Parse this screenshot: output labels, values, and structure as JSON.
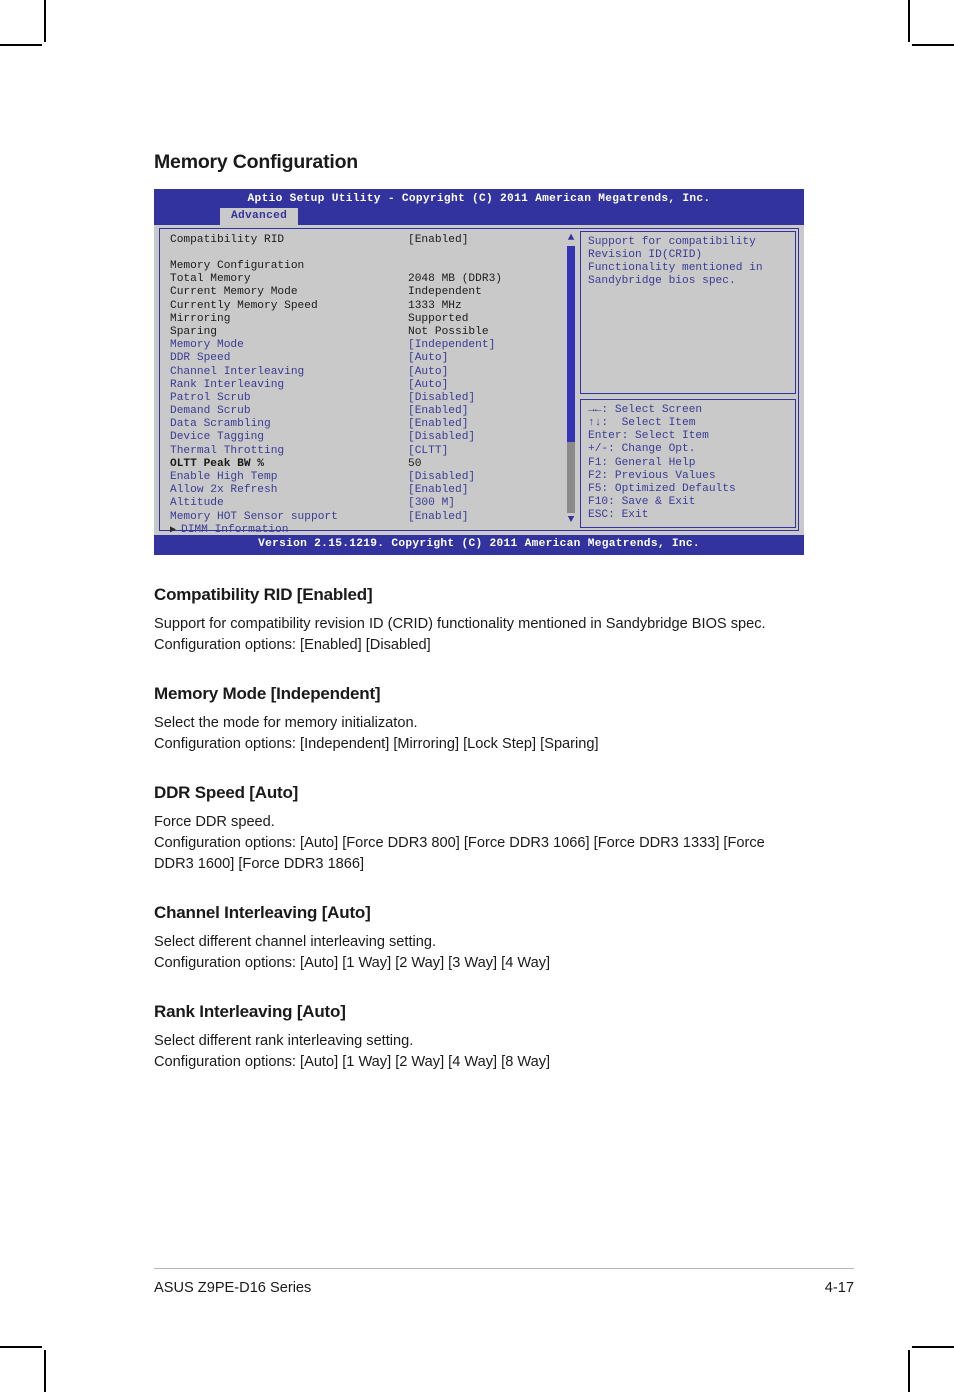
{
  "page": {
    "section_title": "Memory Configuration",
    "footer_left": "ASUS Z9PE-D16 Series",
    "footer_right": "4-17"
  },
  "bios": {
    "title": "Aptio Setup Utility - Copyright (C) 2011 American Megatrends, Inc.",
    "tab": "Advanced",
    "footer": "Version 2.15.1219. Copyright (C) 2011 American Megatrends, Inc.",
    "items": [
      {
        "label": "Compatibility RID",
        "value": "[Enabled]",
        "style": "dark"
      },
      {
        "label": "",
        "value": "",
        "style": "spacer"
      },
      {
        "label": "Memory Configuration",
        "value": "",
        "style": "dark"
      },
      {
        "label": "Total Memory",
        "value": "2048 MB (DDR3)",
        "style": "dark"
      },
      {
        "label": "Current Memory Mode",
        "value": "Independent",
        "style": "dark"
      },
      {
        "label": "Currently Memory Speed",
        "value": "1333 MHz",
        "style": "dark"
      },
      {
        "label": "Mirroring",
        "value": "Supported",
        "style": "dark"
      },
      {
        "label": "Sparing",
        "value": "Not Possible",
        "style": "dark"
      },
      {
        "label": "Memory Mode",
        "value": "[Independent]",
        "style": "blue"
      },
      {
        "label": "DDR Speed",
        "value": "[Auto]",
        "style": "blue"
      },
      {
        "label": "Channel Interleaving",
        "value": "[Auto]",
        "style": "blue"
      },
      {
        "label": "Rank Interleaving",
        "value": "[Auto]",
        "style": "blue"
      },
      {
        "label": "Patrol Scrub",
        "value": "[Disabled]",
        "style": "blue"
      },
      {
        "label": "Demand Scrub",
        "value": "[Enabled]",
        "style": "blue"
      },
      {
        "label": "Data Scrambling",
        "value": "[Enabled]",
        "style": "blue"
      },
      {
        "label": "Device Tagging",
        "value": "[Disabled]",
        "style": "blue"
      },
      {
        "label": "Thermal Throtting",
        "value": "[CLTT]",
        "style": "blue"
      },
      {
        "label": "OLTT Peak BW %",
        "value": "50",
        "style": "bold"
      },
      {
        "label": "Enable High Temp",
        "value": "[Disabled]",
        "style": "blue"
      },
      {
        "label": "Allow 2x Refresh",
        "value": "[Enabled]",
        "style": "blue"
      },
      {
        "label": "Altitude",
        "value": "[300 M]",
        "style": "blue"
      },
      {
        "label": "Memory HOT Sensor support",
        "value": "[Enabled]",
        "style": "blue"
      },
      {
        "label": "DIMM Information",
        "value": "",
        "style": "submenu"
      }
    ],
    "help_text": "Support for compatibility\nRevision ID(CRID)\nFunctionality mentioned in\nSandybridge bios spec.",
    "keys": [
      "→←: Select Screen",
      "↑↓:  Select Item",
      "Enter: Select Item",
      "+/-: Change Opt.",
      "F1: General Help",
      "F2: Previous Values",
      "F5: Optimized Defaults",
      "F10: Save & Exit",
      "ESC: Exit"
    ],
    "scrollbar": {
      "up_arrow": "▲",
      "down_arrow": "▼"
    },
    "colors": {
      "header_blue": "#3333a0",
      "panel_gray": "#c9c9c9",
      "item_blue": "#3b3b96"
    }
  },
  "doc": {
    "sections": [
      {
        "heading": "Compatibility RID [Enabled]",
        "lines": [
          "Support for compatibility revision ID (CRID) functionality mentioned in Sandybridge BIOS spec. Configuration options: [Enabled] [Disabled]"
        ]
      },
      {
        "heading": "Memory Mode [Independent]",
        "lines": [
          "Select the mode for memory initializaton.",
          "Configuration options: [Independent] [Mirroring] [Lock Step] [Sparing]"
        ]
      },
      {
        "heading": "DDR Speed [Auto]",
        "lines": [
          "Force DDR speed.",
          "Configuration options: [Auto] [Force DDR3 800] [Force DDR3 1066] [Force DDR3 1333] [Force DDR3 1600] [Force DDR3 1866]"
        ]
      },
      {
        "heading": "Channel Interleaving [Auto]",
        "lines": [
          "Select different channel interleaving setting.",
          "Configuration options: [Auto] [1 Way] [2 Way] [3 Way] [4 Way]"
        ]
      },
      {
        "heading": "Rank Interleaving [Auto]",
        "lines": [
          "Select different rank interleaving setting.",
          "Configuration options: [Auto] [1 Way] [2 Way] [4 Way] [8 Way]"
        ]
      }
    ]
  }
}
